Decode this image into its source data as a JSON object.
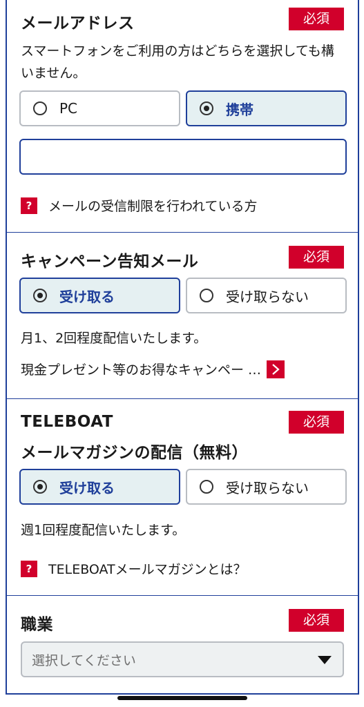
{
  "email": {
    "title": "メールアドレス",
    "required": "必須",
    "description": "スマートフォンをご利用の方はどちらを選択しても構いません。",
    "options": [
      {
        "label": "PC",
        "selected": false
      },
      {
        "label": "携帯",
        "selected": true
      }
    ],
    "input_value": "",
    "help": "メールの受信制限を行われている方",
    "help_icon": "?"
  },
  "campaign": {
    "title": "キャンペーン告知メール",
    "required": "必須",
    "options": [
      {
        "label": "受け取る",
        "selected": true
      },
      {
        "label": "受け取らない",
        "selected": false
      }
    ],
    "description": "月1、2回程度配信いたします。",
    "more_text": "現金プレゼント等のお得なキャンペー …"
  },
  "magazine": {
    "title_line1": "TELEBOAT",
    "title_line2": "メールマガジンの配信（無料）",
    "required": "必須",
    "options": [
      {
        "label": "受け取る",
        "selected": true
      },
      {
        "label": "受け取らない",
        "selected": false
      }
    ],
    "description": "週1回程度配信いたします。",
    "help": "TELEBOATメールマガジンとは？",
    "help_icon": "?"
  },
  "occupation": {
    "title": "職業",
    "required": "必須",
    "select_placeholder": "選択してください"
  },
  "colors": {
    "accent": "#1f3f9a",
    "required_bg": "#d1002b",
    "selected_bg": "#e5f0f2"
  }
}
